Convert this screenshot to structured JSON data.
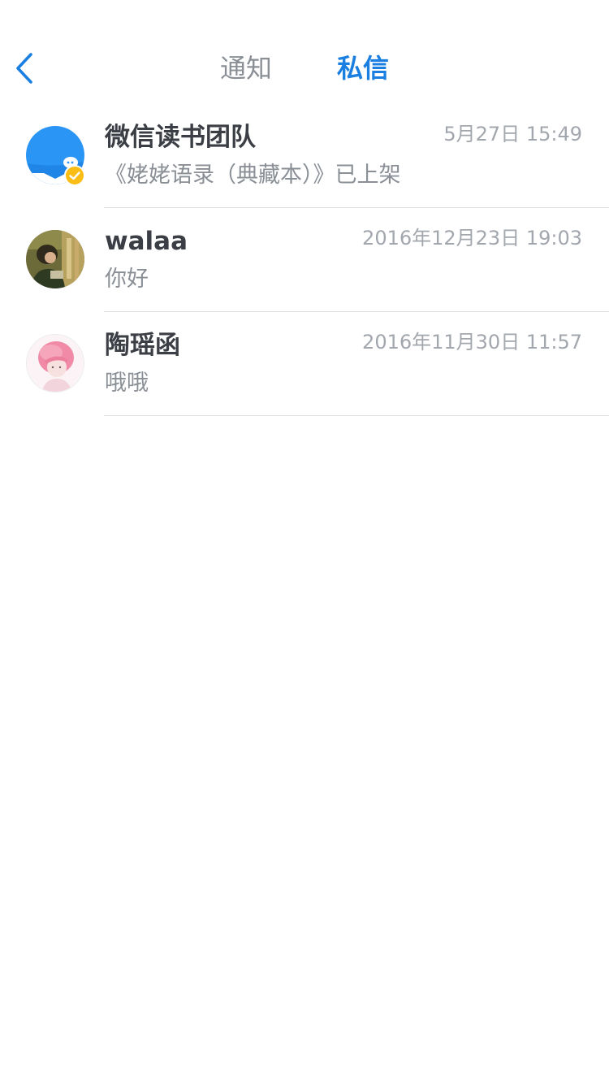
{
  "header": {
    "back_icon": "chevron-left-icon",
    "tabs": [
      {
        "label": "通知",
        "active": false
      },
      {
        "label": "私信",
        "active": true
      }
    ],
    "accent_color": "#1a7fe0"
  },
  "conversations": [
    {
      "name": "微信读书团队",
      "time": "5月27日 15:49",
      "preview": "《姥姥语录（典藏本）》已上架",
      "avatar": "wechat-reading-logo-icon",
      "verified": true
    },
    {
      "name": "walaa",
      "time": "2016年12月23日 19:03",
      "preview": "你好",
      "avatar": "user-photo-avatar"
    },
    {
      "name": "陶瑶函",
      "time": "2016年11月30日 11:57",
      "preview": "哦哦",
      "avatar": "user-photo-avatar"
    }
  ]
}
